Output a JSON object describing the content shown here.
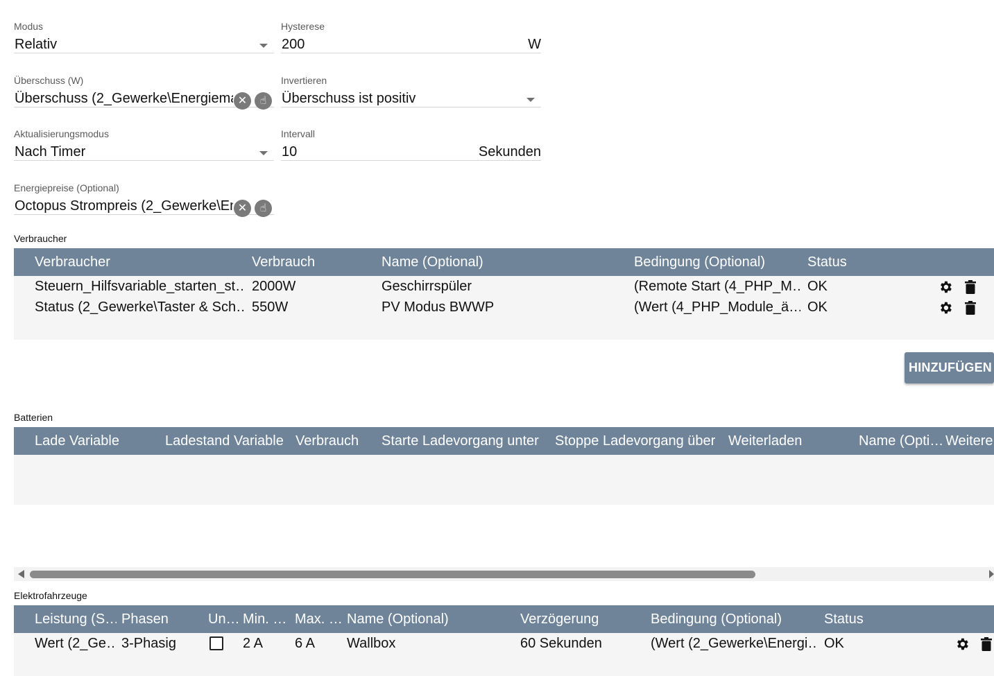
{
  "form": {
    "modus": {
      "label": "Modus",
      "value": "Relativ"
    },
    "hysterese": {
      "label": "Hysterese",
      "value": "200",
      "suffix": "W"
    },
    "ueberschuss": {
      "label": "Überschuss (W)",
      "value": "Überschuss (2_Gewerke\\Energiema"
    },
    "invertieren": {
      "label": "Invertieren",
      "value": "Überschuss ist positiv"
    },
    "aktualisierungsmodus": {
      "label": "Aktualisierungsmodus",
      "value": "Nach Timer"
    },
    "intervall": {
      "label": "Intervall",
      "value": "10",
      "suffix": "Sekunden"
    },
    "energiepreise": {
      "label": "Energiepreise (Optional)",
      "value": "Octopus Strompreis (2_Gewerke\\En"
    }
  },
  "verbraucher": {
    "section_label": "Verbraucher",
    "columns": [
      "Verbraucher",
      "Verbrauch",
      "Name (Optional)",
      "Bedingung (Optional)",
      "Status"
    ],
    "rows": [
      [
        "Steuern_Hilfsvariable_starten_st…",
        "2000W",
        "Geschirrspüler",
        "(Remote Start (4_PHP_M…",
        "OK"
      ],
      [
        "Status (2_Gewerke\\Taster & Sch…",
        "550W",
        "PV Modus BWWP",
        "(Wert (4_PHP_Module_ä…",
        "OK"
      ]
    ],
    "add_button": "HINZUFÜGEN"
  },
  "batterien": {
    "section_label": "Batterien",
    "columns": [
      "Lade Variable",
      "Ladestand Variable",
      "Verbrauch",
      "Starte Ladevorgang unter",
      "Stoppe Ladevorgang über",
      "Weiterladen",
      "Name (Opti…",
      "Weitere"
    ]
  },
  "elektrofahrzeuge": {
    "section_label": "Elektrofahrzeuge",
    "columns": [
      "Leistung (S…",
      "Phasen",
      "Un…",
      "Min. …",
      "Max. …",
      "Name (Optional)",
      "Verzögerung",
      "Bedingung (Optional)",
      "Status"
    ],
    "rows": [
      [
        "Wert (2_Ge…",
        "3-Phasig",
        "",
        "2 A",
        "6 A",
        "Wallbox",
        "60 Sekunden",
        "(Wert (2_Gewerke\\Energi…",
        "OK"
      ]
    ]
  },
  "colors": {
    "table_header": "#6f8499",
    "table_body": "#f5f5f5",
    "scrollbar_thumb": "#8a8a8a"
  },
  "icons": [
    "close-circle-icon",
    "pointer-hand-icon",
    "gear-icon",
    "trash-icon",
    "chevron-down-icon"
  ]
}
